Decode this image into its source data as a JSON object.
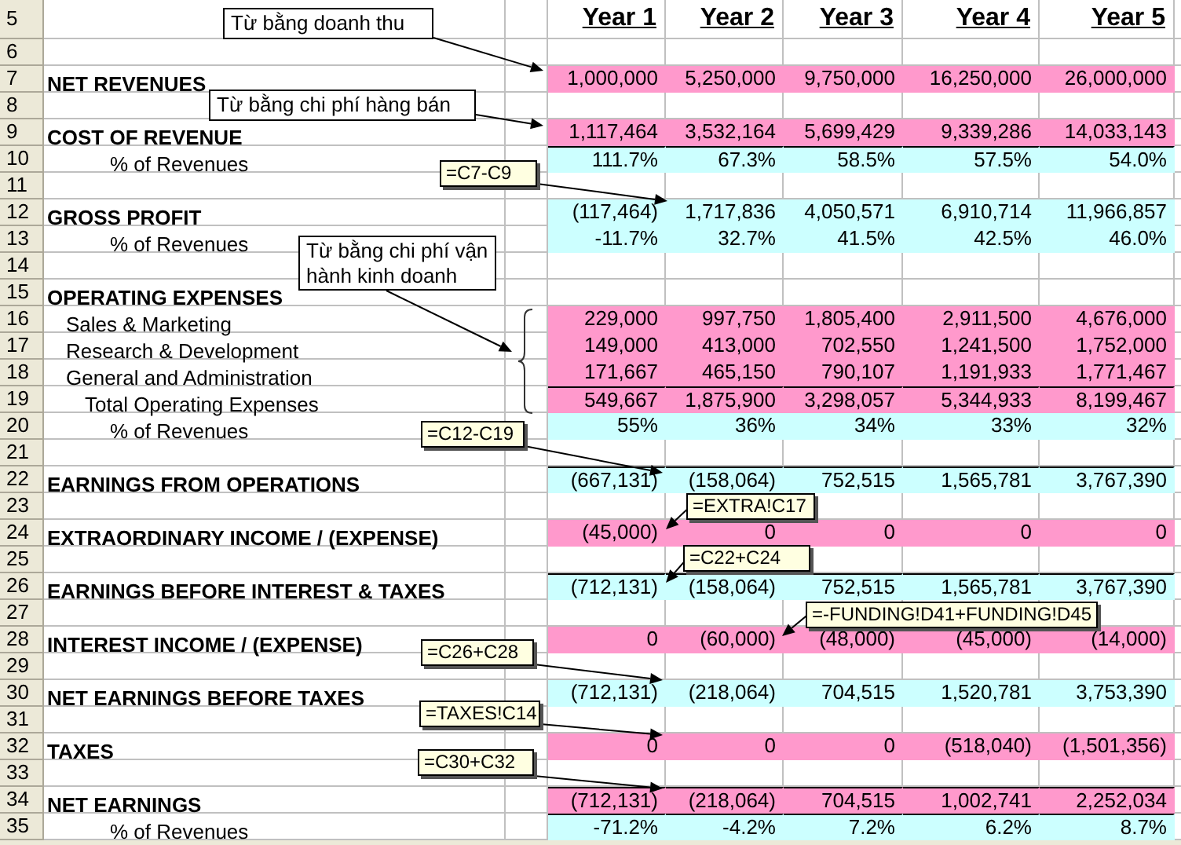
{
  "header": {
    "num": "5",
    "columns": [
      "Year 1",
      "Year 2",
      "Year 3",
      "Year 4",
      "Year 5"
    ]
  },
  "rows": [
    {
      "num": "6",
      "kind": "blank"
    },
    {
      "num": "7",
      "kind": "heading",
      "label": "NET REVENUES",
      "color": "#ff99cc",
      "values": [
        "1,000,000",
        "5,250,000",
        "9,750,000",
        "16,250,000",
        "26,000,000"
      ]
    },
    {
      "num": "8",
      "kind": "blank"
    },
    {
      "num": "9",
      "kind": "heading",
      "label": "COST OF REVENUE",
      "color": "#ff99cc",
      "values": [
        "1,117,464",
        "3,532,164",
        "5,699,429",
        "9,339,286",
        "14,033,143"
      ]
    },
    {
      "num": "10",
      "kind": "percent",
      "label": "% of Revenues",
      "color": "#ccffff",
      "rule_above": true,
      "values": [
        "111.7%",
        "67.3%",
        "58.5%",
        "57.5%",
        "54.0%"
      ]
    },
    {
      "num": "11",
      "kind": "blank"
    },
    {
      "num": "12",
      "kind": "heading",
      "label": "GROSS PROFIT",
      "color": "#ccffff",
      "values": [
        "(117,464)",
        "1,717,836",
        "4,050,571",
        "6,910,714",
        "11,966,857"
      ]
    },
    {
      "num": "13",
      "kind": "percent",
      "label": "% of Revenues",
      "color": "#ccffff",
      "values": [
        "-11.7%",
        "32.7%",
        "41.5%",
        "42.5%",
        "46.0%"
      ]
    },
    {
      "num": "14",
      "kind": "blank"
    },
    {
      "num": "15",
      "kind": "heading",
      "label": "OPERATING EXPENSES"
    },
    {
      "num": "16",
      "kind": "item",
      "label": "Sales & Marketing",
      "color": "#ff99cc",
      "values": [
        "229,000",
        "997,750",
        "1,805,400",
        "2,911,500",
        "4,676,000"
      ]
    },
    {
      "num": "17",
      "kind": "item",
      "label": "Research & Development",
      "color": "#ff99cc",
      "values": [
        "149,000",
        "413,000",
        "702,550",
        "1,241,500",
        "1,752,000"
      ]
    },
    {
      "num": "18",
      "kind": "item",
      "label": "General and Administration",
      "color": "#ff99cc",
      "values": [
        "171,667",
        "465,150",
        "790,107",
        "1,191,933",
        "1,771,467"
      ]
    },
    {
      "num": "19",
      "kind": "total",
      "label": "Total Operating Expenses",
      "color": "#ff99cc",
      "rule_above": true,
      "values": [
        "549,667",
        "1,875,900",
        "3,298,057",
        "5,344,933",
        "8,199,467"
      ]
    },
    {
      "num": "20",
      "kind": "percent",
      "label": "% of Revenues",
      "color": "#ccffff",
      "values": [
        "55%",
        "36%",
        "34%",
        "33%",
        "32%"
      ]
    },
    {
      "num": "21",
      "kind": "blank"
    },
    {
      "num": "22",
      "kind": "heading",
      "label": "EARNINGS FROM OPERATIONS",
      "color": "#ccffff",
      "rule_above": true,
      "values": [
        "(667,131)",
        "(158,064)",
        "752,515",
        "1,565,781",
        "3,767,390"
      ]
    },
    {
      "num": "23",
      "kind": "blank"
    },
    {
      "num": "24",
      "kind": "heading",
      "label": "EXTRAORDINARY INCOME / (EXPENSE)",
      "color": "#ff99cc",
      "values": [
        "(45,000)",
        "0",
        "0",
        "0",
        "0"
      ]
    },
    {
      "num": "25",
      "kind": "blank"
    },
    {
      "num": "26",
      "kind": "heading",
      "label": "EARNINGS BEFORE INTEREST & TAXES",
      "color": "#ccffff",
      "rule_above": true,
      "values": [
        "(712,131)",
        "(158,064)",
        "752,515",
        "1,565,781",
        "3,767,390"
      ]
    },
    {
      "num": "27",
      "kind": "blank"
    },
    {
      "num": "28",
      "kind": "heading",
      "label": "INTEREST INCOME / (EXPENSE)",
      "color": "#ff99cc",
      "values": [
        "0",
        "(60,000)",
        "(48,000)",
        "(45,000)",
        "(14,000)"
      ]
    },
    {
      "num": "29",
      "kind": "blank"
    },
    {
      "num": "30",
      "kind": "heading",
      "label": "NET EARNINGS BEFORE TAXES",
      "color": "#ccffff",
      "values": [
        "(712,131)",
        "(218,064)",
        "704,515",
        "1,520,781",
        "3,753,390"
      ]
    },
    {
      "num": "31",
      "kind": "blank"
    },
    {
      "num": "32",
      "kind": "heading",
      "label": "TAXES",
      "color": "#ff99cc",
      "values": [
        "0",
        "0",
        "0",
        "(518,040)",
        "(1,501,356)"
      ]
    },
    {
      "num": "33",
      "kind": "blank"
    },
    {
      "num": "34",
      "kind": "heading",
      "label": "NET EARNINGS",
      "color": "#ff99cc",
      "rule_above": true,
      "values": [
        "(712,131)",
        "(218,064)",
        "704,515",
        "1,002,741",
        "2,252,034"
      ]
    },
    {
      "num": "35",
      "kind": "percent",
      "label": "% of Revenues",
      "color": "#ccffff",
      "rule_above": true,
      "values": [
        "-71.2%",
        "-4.2%",
        "7.2%",
        "6.2%",
        "8.7%"
      ]
    }
  ],
  "callouts": [
    {
      "kind": "note",
      "text": "Từ bằng doanh thu"
    },
    {
      "kind": "note",
      "text": "Từ bằng chi phí hàng bán"
    },
    {
      "kind": "formula",
      "text": "=C7-C9"
    },
    {
      "kind": "note",
      "text": "Từ bằng chi phí vận hành kinh doanh"
    },
    {
      "kind": "formula",
      "text": "=C12-C19"
    },
    {
      "kind": "formula",
      "text": "=EXTRA!C17"
    },
    {
      "kind": "formula",
      "text": "=C22+C24"
    },
    {
      "kind": "formula",
      "text": "=-FUNDING!D41+FUNDING!D45"
    },
    {
      "kind": "formula",
      "text": "=C26+C28"
    },
    {
      "kind": "formula",
      "text": "=TAXES!C14"
    },
    {
      "kind": "formula",
      "text": "=C30+C32"
    }
  ]
}
